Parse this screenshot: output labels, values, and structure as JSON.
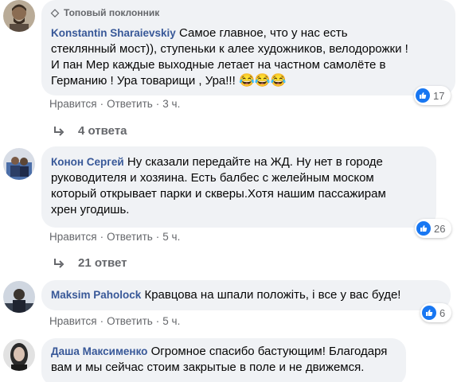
{
  "comments": [
    {
      "badge": "Топовый поклонник",
      "author": "Konstantin Sharaievskiy",
      "line1": "Самое главное, что у нас есть",
      "line2": "стеклянный мост)), ступеньки к алее художников, велодорожки !",
      "line3": "И пан Мер каждые выходные летает на частном самолёте в",
      "line4": "Германию ! Ура товарищи , Ура!!!",
      "emoji": "😂😂😂",
      "like": "Нравится",
      "reply": "Ответить",
      "time": "3 ч.",
      "reactions": "17",
      "replies": "4 ответа"
    },
    {
      "author": "Конон Сергей",
      "line1": "Ну сказали передайте на ЖД. Ну нет в городе",
      "line2": "руководителя и хозяина. Есть балбес с желейным моском",
      "line3": "который открывает парки и скверы.Хотя нашим пассажирам",
      "line4": "хрен угодишь.",
      "like": "Нравится",
      "reply": "Ответить",
      "time": "5 ч.",
      "reactions": "26",
      "replies": "21 ответ"
    },
    {
      "author": "Maksim Paholock",
      "line1": "Кравцова на шпали положіть, і все у вас буде!",
      "like": "Нравится",
      "reply": "Ответить",
      "time": "5 ч.",
      "reactions": "6"
    },
    {
      "author": "Даша Максименко",
      "line1": "Огромное спасибо бастующим! Благодаря",
      "line2": "вам и мы сейчас стоим закрытые в поле и не движемся."
    }
  ],
  "separator": "·",
  "icons": {
    "badge": "diamond-icon",
    "like": "thumbs-up-icon",
    "replies": "reply-arrow-icon"
  },
  "colors": {
    "author": "#385898",
    "bubble": "#f0f2f5",
    "like_blue": "#1877f2",
    "meta": "#65676b"
  }
}
